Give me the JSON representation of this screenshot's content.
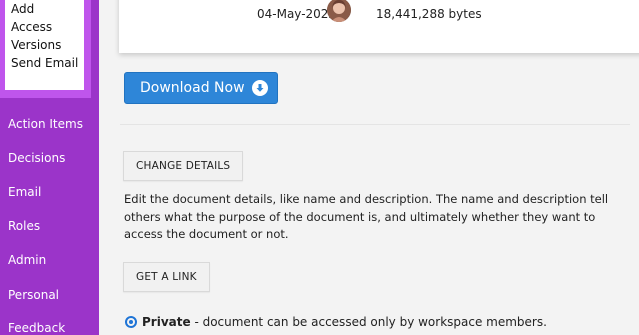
{
  "sidebar": {
    "submenu": [
      "Add",
      "Access",
      "Versions",
      "Send Email"
    ],
    "items": [
      "Action Items",
      "Decisions",
      "Email",
      "Roles",
      "Admin",
      "Personal",
      "Feedback"
    ]
  },
  "document": {
    "date": "04-May-2022",
    "size": "18,441,288 bytes"
  },
  "download": {
    "label": "Download Now"
  },
  "change_details": {
    "label": "CHANGE DETAILS",
    "description": "Edit the document details, like name and description. The name and description tell others what the purpose of the document is, and ultimately whether they want to access the document or not."
  },
  "get_link": {
    "label": "GET A LINK"
  },
  "privacy": {
    "option_label": "Private",
    "option_text": " - document can be accessed only by workspace members."
  }
}
